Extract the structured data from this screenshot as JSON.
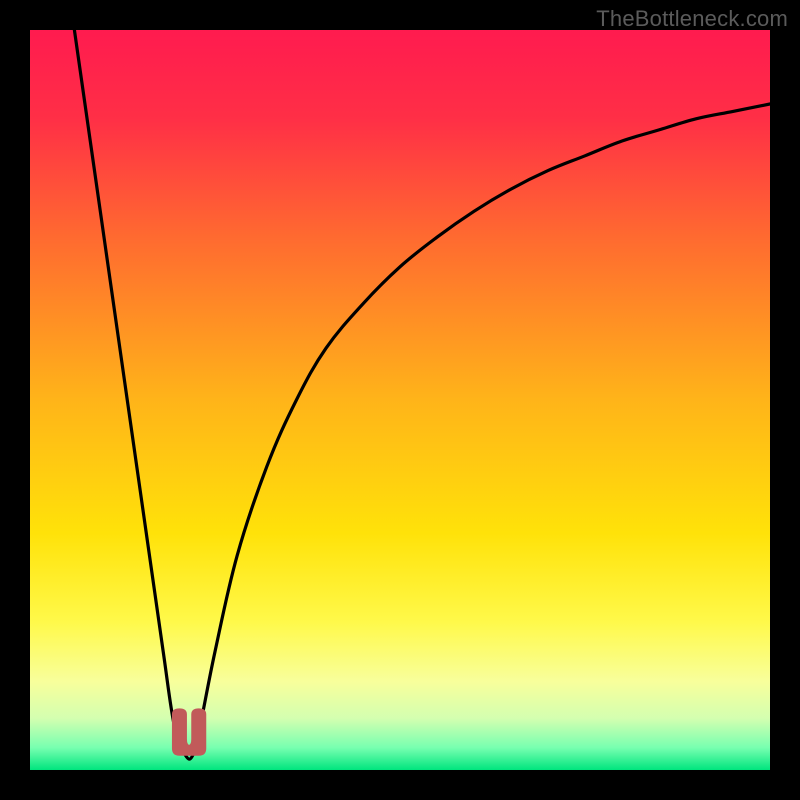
{
  "watermark": {
    "text": "TheBottleneck.com"
  },
  "chart_data": {
    "type": "line",
    "title": "",
    "xlabel": "",
    "ylabel": "",
    "xlim": [
      0,
      100
    ],
    "ylim": [
      0,
      100
    ],
    "grid": false,
    "legend": {
      "position": "none"
    },
    "gradient_stops": [
      {
        "pos": 0.0,
        "color": "#ff1b4f"
      },
      {
        "pos": 0.12,
        "color": "#ff2f46"
      },
      {
        "pos": 0.28,
        "color": "#ff6a30"
      },
      {
        "pos": 0.5,
        "color": "#ffb419"
      },
      {
        "pos": 0.68,
        "color": "#ffe209"
      },
      {
        "pos": 0.8,
        "color": "#fff94a"
      },
      {
        "pos": 0.88,
        "color": "#f8ff9b"
      },
      {
        "pos": 0.93,
        "color": "#d4ffb0"
      },
      {
        "pos": 0.97,
        "color": "#77ffb0"
      },
      {
        "pos": 1.0,
        "color": "#00e57e"
      }
    ],
    "series": [
      {
        "name": "bottleneck-curve",
        "x": [
          6,
          8,
          10,
          12,
          14,
          16,
          18,
          19.5,
          21,
          22,
          23,
          25,
          28,
          32,
          36,
          40,
          45,
          50,
          55,
          60,
          65,
          70,
          75,
          80,
          85,
          90,
          95,
          100
        ],
        "y": [
          100,
          86,
          72,
          58,
          44,
          30,
          16,
          6,
          2,
          2,
          6,
          16,
          29,
          41,
          50,
          57,
          63,
          68,
          72,
          75.5,
          78.5,
          81,
          83,
          85,
          86.5,
          88,
          89,
          90
        ]
      }
    ],
    "marker": {
      "name": "optimal-point",
      "x": 21.5,
      "y": 2,
      "width": 4.5,
      "height": 5.5,
      "color": "#c15a5a"
    },
    "annotations": []
  }
}
